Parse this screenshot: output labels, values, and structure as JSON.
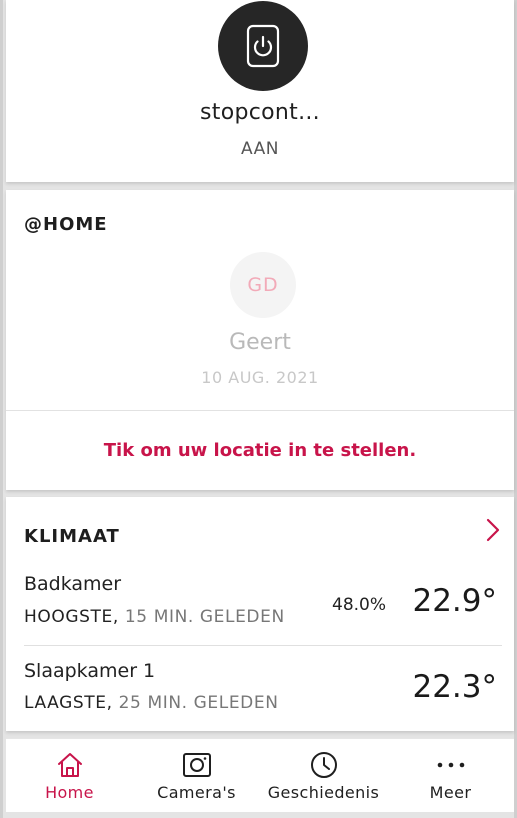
{
  "device": {
    "name": "stopcont...",
    "state": "AAN",
    "icon": "power-socket-icon"
  },
  "home": {
    "title": "@HOME",
    "user": {
      "initials": "GD",
      "name": "Geert",
      "date": "10 AUG. 2021"
    },
    "location_prompt": "Tik om uw locatie in te stellen."
  },
  "climate": {
    "title": "KLIMAAT",
    "rooms": [
      {
        "name": "Badkamer",
        "level": "HOOGSTE,",
        "ago": "15 MIN. GELEDEN",
        "humidity": "48.0%",
        "temperature": "22.9°"
      },
      {
        "name": "Slaapkamer 1",
        "level": "LAAGSTE,",
        "ago": "25 MIN. GELEDEN",
        "humidity": "",
        "temperature": "22.3°"
      }
    ]
  },
  "nav": {
    "items": [
      {
        "label": "Home",
        "icon": "home-icon",
        "active": true
      },
      {
        "label": "Camera's",
        "icon": "camera-icon",
        "active": false
      },
      {
        "label": "Geschiedenis",
        "icon": "clock-icon",
        "active": false
      },
      {
        "label": "Meer",
        "icon": "more-dots-icon",
        "active": false
      }
    ]
  },
  "colors": {
    "accent": "#c8144a",
    "device_circle": "#262626"
  }
}
